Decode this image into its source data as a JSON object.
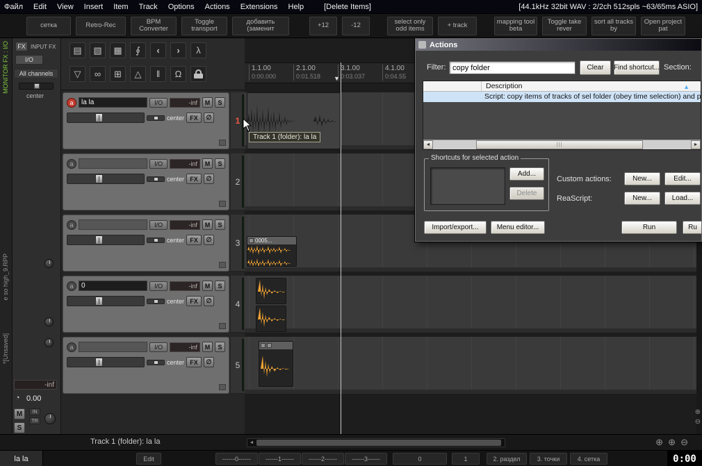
{
  "menubar": {
    "items": [
      "Файл",
      "Edit",
      "View",
      "Insert",
      "Item",
      "Track",
      "Options",
      "Actions",
      "Extensions",
      "Help",
      "[Delete Items]"
    ],
    "status": "[44.1kHz 32bit WAV : 2/2ch 512spls ~63/65ms ASIO]"
  },
  "toolbar": {
    "buttons": [
      "сетка",
      "Retro-Rec",
      "BPM Converter",
      "Toggle transport",
      "добавить (заменит",
      "+12",
      "-12",
      "select only odd items",
      "+ track",
      "mapping tool beta",
      "Toggle take rever",
      "sort all tracks by",
      "Open project pat"
    ]
  },
  "left_strip": {
    "monitor_fx": "MONITOR FX : I/O",
    "project_name": "е so high_9.RPP",
    "unsaved": "*[Unsaved]"
  },
  "left_panel": {
    "fx": "FX",
    "input_fx": "INPUT FX",
    "io": "I/O",
    "channels": "All channels",
    "pan": "center",
    "vol": "-inf",
    "time": "0.00",
    "mute": "M",
    "solo": "S",
    "mon_in": "IN",
    "mon_tr": "TR"
  },
  "icons": {
    "record_arm": "a",
    "new_project": "▤",
    "open_project": "▧",
    "save_project": "▦",
    "paperclip": "∮",
    "undo": "‹",
    "redo": "›",
    "actions": "λ",
    "filter": "▽",
    "link": "∞",
    "grid": "⊞",
    "trim": "△",
    "ripple": "‖",
    "snap": "Ω",
    "clock": "◔",
    "sort": "▲",
    "scroll_left": "◄",
    "scroll_right": "►",
    "zoom_in": "⊕",
    "zoom_out": "⊖",
    "marker": "▼"
  },
  "tracks": [
    {
      "num": "1",
      "name": "la la",
      "io": "I/O",
      "vol": "-inf",
      "mute": "M",
      "solo": "S",
      "pan": "center",
      "fx": "FX",
      "phase": "∅"
    },
    {
      "num": "2",
      "name": "",
      "io": "I/O",
      "vol": "-inf",
      "mute": "M",
      "solo": "S",
      "pan": "center",
      "fx": "FX",
      "phase": "∅"
    },
    {
      "num": "3",
      "name": "",
      "io": "I/O",
      "vol": "-inf",
      "mute": "M",
      "solo": "S",
      "pan": "center",
      "fx": "FX",
      "phase": "∅"
    },
    {
      "num": "4",
      "name": "0",
      "io": "I/O",
      "vol": "-inf",
      "mute": "M",
      "solo": "S",
      "pan": "center",
      "fx": "FX",
      "phase": "∅"
    },
    {
      "num": "5",
      "name": "",
      "io": "I/O",
      "vol": "-inf",
      "mute": "M",
      "solo": "S",
      "pan": "center",
      "fx": "FX",
      "phase": "∅"
    }
  ],
  "ruler": {
    "marks": [
      {
        "bar": "1.1.00",
        "time": "0:00.000"
      },
      {
        "bar": "2.1.00",
        "time": "0:01.518"
      },
      {
        "bar": "3.1.00",
        "time": "0:03.037"
      },
      {
        "bar": "4.1.00",
        "time": "0:04.55"
      }
    ]
  },
  "arrange": {
    "item_label": "0005...",
    "tooltip": "Track 1 (folder): la la"
  },
  "actions_dialog": {
    "title": "Actions",
    "filter_label": "Filter:",
    "filter_value": "copy folder",
    "clear_button": "Clear",
    "find_shortcut_button": "Find shortcut...",
    "section_label": "Section:",
    "list_header": "Description",
    "selected_row": "Script: copy items of tracks of sel folder (obey time selection) and paste",
    "shortcuts_group_label": "Shortcuts for selected action",
    "add_button": "Add...",
    "delete_button": "Delete",
    "custom_actions_label": "Custom actions:",
    "custom_new_button": "New...",
    "custom_edit_button": "Edit...",
    "reascript_label": "ReaScript:",
    "reascript_new_button": "New...",
    "reascript_load_button": "Load...",
    "import_export_button": "Import/export...",
    "menu_editor_button": "Menu editor...",
    "run_button": "Run",
    "run_close_button": "Ru"
  },
  "status_bar": {
    "text": "Track 1 (folder): la la"
  },
  "bottom_bar": {
    "track_name": "la la",
    "edit_button": "Edit",
    "tabs": [
      "------0------",
      "------1------",
      "------2------",
      "------3------"
    ],
    "tabs2": [
      "0",
      "1",
      "2. раздел",
      "3. точки",
      "4. сетка"
    ],
    "time": "0:00"
  }
}
